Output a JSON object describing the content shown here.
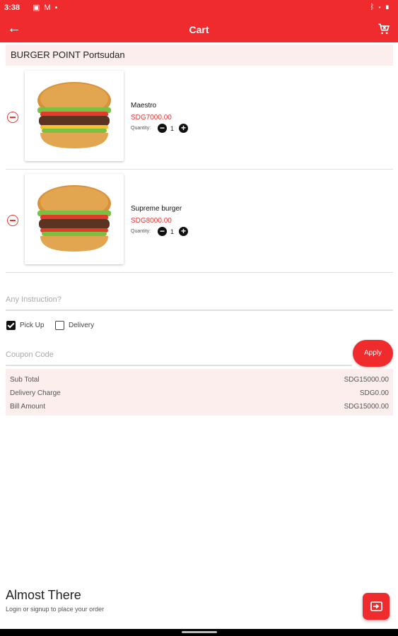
{
  "status_bar": {
    "time": "3:38",
    "left_icons": [
      "sim-icon",
      "mail-icon",
      "dot-icon"
    ],
    "right_icons": [
      "bluetooth-icon",
      "wifi-icon",
      "battery-icon"
    ]
  },
  "app_bar": {
    "title": "Cart",
    "back_icon": "arrow-left-icon",
    "action_icon": "clear-cart-icon"
  },
  "restaurant_name": "BURGER POINT Portsudan",
  "items": [
    {
      "name": "Maestro",
      "price": "SDG7000.00",
      "quantity_label": "Quantity:",
      "quantity": "1"
    },
    {
      "name": "Supreme burger",
      "price": "SDG8000.00",
      "quantity_label": "Quantity:",
      "quantity": "1"
    }
  ],
  "instruction": {
    "placeholder": "Any Instruction?",
    "value": ""
  },
  "options": {
    "pickup_label": "Pick Up",
    "pickup_checked": true,
    "delivery_label": "Delivery",
    "delivery_checked": false
  },
  "coupon": {
    "placeholder": "Coupon Code",
    "value": "",
    "apply_label": "Apply"
  },
  "summary": {
    "sub_total_label": "Sub Total",
    "sub_total": "SDG15000.00",
    "delivery_label": "Delivery Charge",
    "delivery": "SDG0.00",
    "bill_label": "Bill Amount",
    "bill": "SDG15000.00"
  },
  "footer": {
    "title": "Almost There",
    "subtitle": "Login or signup to place your order",
    "fab_icon": "login-icon"
  },
  "colors": {
    "primary": "#ef2b2d",
    "price": "#e53935",
    "highlight_bg": "#fbeeed"
  }
}
